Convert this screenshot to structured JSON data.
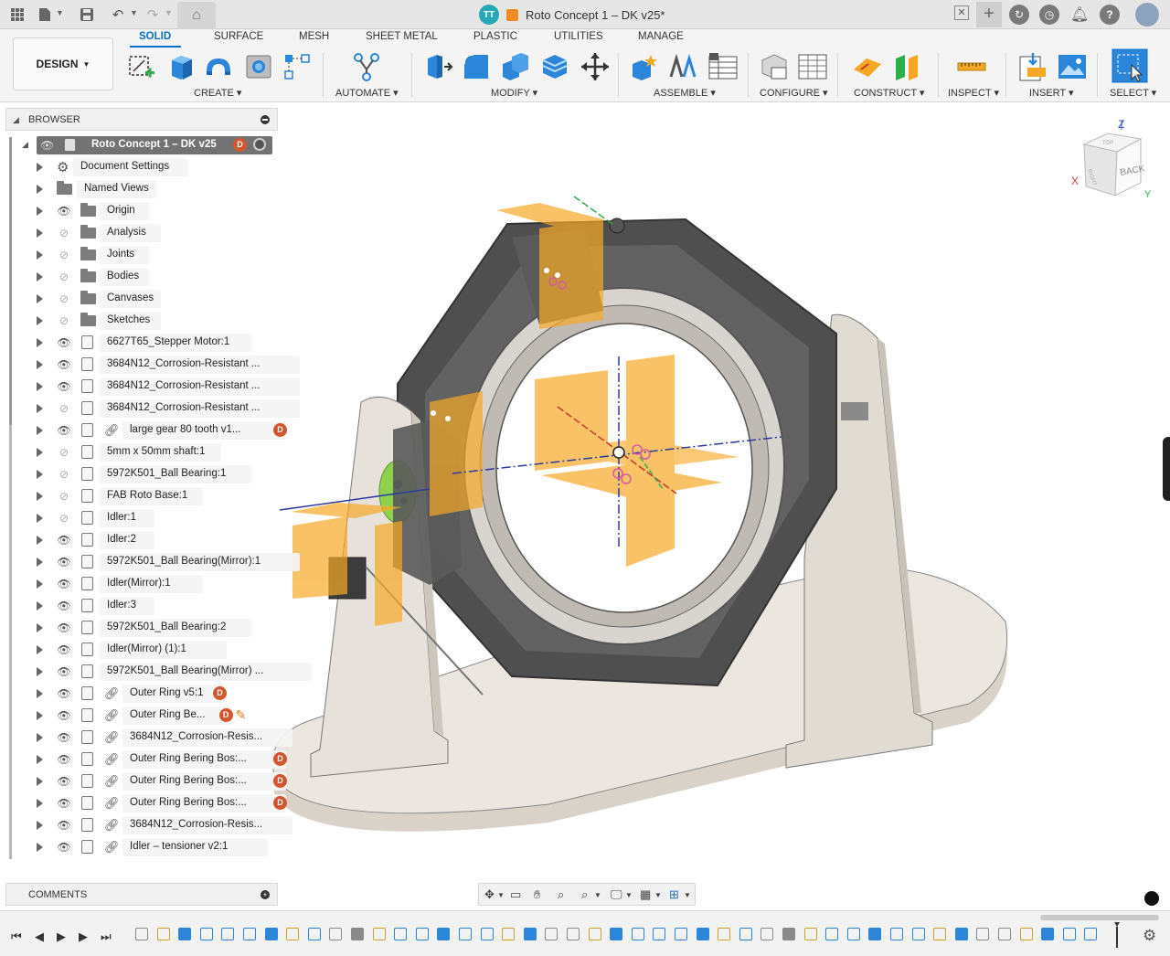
{
  "window": {
    "document_title": "Roto Concept 1 – DK v25*",
    "user_initials": "TT"
  },
  "ribbon": {
    "workspace_label": "DESIGN",
    "tabs": [
      {
        "label": "SOLID",
        "active": true
      },
      {
        "label": "SURFACE",
        "active": false
      },
      {
        "label": "MESH",
        "active": false
      },
      {
        "label": "SHEET METAL",
        "active": false
      },
      {
        "label": "PLASTIC",
        "active": false
      },
      {
        "label": "UTILITIES",
        "active": false
      },
      {
        "label": "MANAGE",
        "active": false
      }
    ],
    "groups": [
      {
        "label": "CREATE ▾"
      },
      {
        "label": "AUTOMATE ▾"
      },
      {
        "label": "MODIFY ▾"
      },
      {
        "label": "ASSEMBLE ▾"
      },
      {
        "label": "CONFIGURE ▾"
      },
      {
        "label": "CONSTRUCT ▾"
      },
      {
        "label": "INSPECT ▾"
      },
      {
        "label": "INSERT ▾"
      },
      {
        "label": "SELECT ▾"
      }
    ]
  },
  "browser": {
    "title": "BROWSER",
    "root": "Roto Concept 1 – DK v25",
    "items": [
      {
        "label": "Document Settings",
        "icon": "gear-icon",
        "eye": "none"
      },
      {
        "label": "Named Views",
        "icon": "folder-icon",
        "eye": "none"
      },
      {
        "label": "Origin",
        "icon": "folder-icon",
        "eye": "visible"
      },
      {
        "label": "Analysis",
        "icon": "folder-icon",
        "eye": "hidden"
      },
      {
        "label": "Joints",
        "icon": "folder-icon",
        "eye": "hidden"
      },
      {
        "label": "Bodies",
        "icon": "folder-icon",
        "eye": "hidden"
      },
      {
        "label": "Canvases",
        "icon": "folder-icon",
        "eye": "hidden"
      },
      {
        "label": "Sketches",
        "icon": "folder-icon",
        "eye": "hidden"
      },
      {
        "label": "6627T65_Stepper Motor:1",
        "icon": "component-icon",
        "eye": "visible"
      },
      {
        "label": "3684N12_Corrosion-Resistant ...",
        "icon": "component-icon",
        "eye": "visible"
      },
      {
        "label": "3684N12_Corrosion-Resistant ...",
        "icon": "component-icon",
        "eye": "visible"
      },
      {
        "label": "3684N12_Corrosion-Resistant ...",
        "icon": "component-icon",
        "eye": "hidden"
      },
      {
        "label": "large gear 80 tooth v1...",
        "icon": "linked-component-icon",
        "eye": "visible",
        "badge": "D"
      },
      {
        "label": "5mm x 50mm shaft:1",
        "icon": "component-icon",
        "eye": "hidden"
      },
      {
        "label": "5972K501_Ball Bearing:1",
        "icon": "component-icon",
        "eye": "hidden"
      },
      {
        "label": "FAB Roto Base:1",
        "icon": "component-icon",
        "eye": "hidden"
      },
      {
        "label": "Idler:1",
        "icon": "component-icon",
        "eye": "hidden"
      },
      {
        "label": "Idler:2",
        "icon": "component-icon",
        "eye": "visible"
      },
      {
        "label": "5972K501_Ball Bearing(Mirror):1",
        "icon": "component-icon",
        "eye": "visible"
      },
      {
        "label": "Idler(Mirror):1",
        "icon": "component-icon",
        "eye": "visible"
      },
      {
        "label": "Idler:3",
        "icon": "component-icon",
        "eye": "visible"
      },
      {
        "label": "5972K501_Ball Bearing:2",
        "icon": "component-icon",
        "eye": "visible"
      },
      {
        "label": "Idler(Mirror) (1):1",
        "icon": "component-icon",
        "eye": "visible"
      },
      {
        "label": "5972K501_Ball Bearing(Mirror) ...",
        "icon": "component-icon",
        "eye": "visible"
      },
      {
        "label": "Outer Ring v5:1",
        "icon": "linked-component-icon",
        "eye": "visible",
        "badge": "D"
      },
      {
        "label": "Outer Ring Be...",
        "icon": "linked-component-icon",
        "eye": "visible",
        "badge": "D",
        "edit": true
      },
      {
        "label": "3684N12_Corrosion-Resis...",
        "icon": "linked-component-icon",
        "eye": "visible"
      },
      {
        "label": "Outer Ring Bering Bos:...",
        "icon": "linked-component-icon",
        "eye": "visible",
        "badge": "D"
      },
      {
        "label": "Outer Ring Bering Bos:...",
        "icon": "linked-component-icon",
        "eye": "visible",
        "badge": "D"
      },
      {
        "label": "Outer Ring Bering Bos:...",
        "icon": "linked-component-icon",
        "eye": "visible",
        "badge": "D"
      },
      {
        "label": "3684N12_Corrosion-Resis...",
        "icon": "linked-component-icon",
        "eye": "visible"
      },
      {
        "label": "Idler – tensioner v2:1",
        "icon": "linked-component-icon",
        "eye": "visible"
      }
    ]
  },
  "comments": {
    "title": "COMMENTS"
  },
  "viewcube": {
    "face_label": "BACK",
    "top_label": "TOP",
    "side_label": "RIGHT",
    "axis_x": "X",
    "axis_y": "Y",
    "axis_z": "Z"
  },
  "colors": {
    "accent": "#0b6fc7",
    "plane": "#f7a928",
    "badge": "#d4562e",
    "wood": "#e8e3dc",
    "dark_frame": "#545454"
  }
}
